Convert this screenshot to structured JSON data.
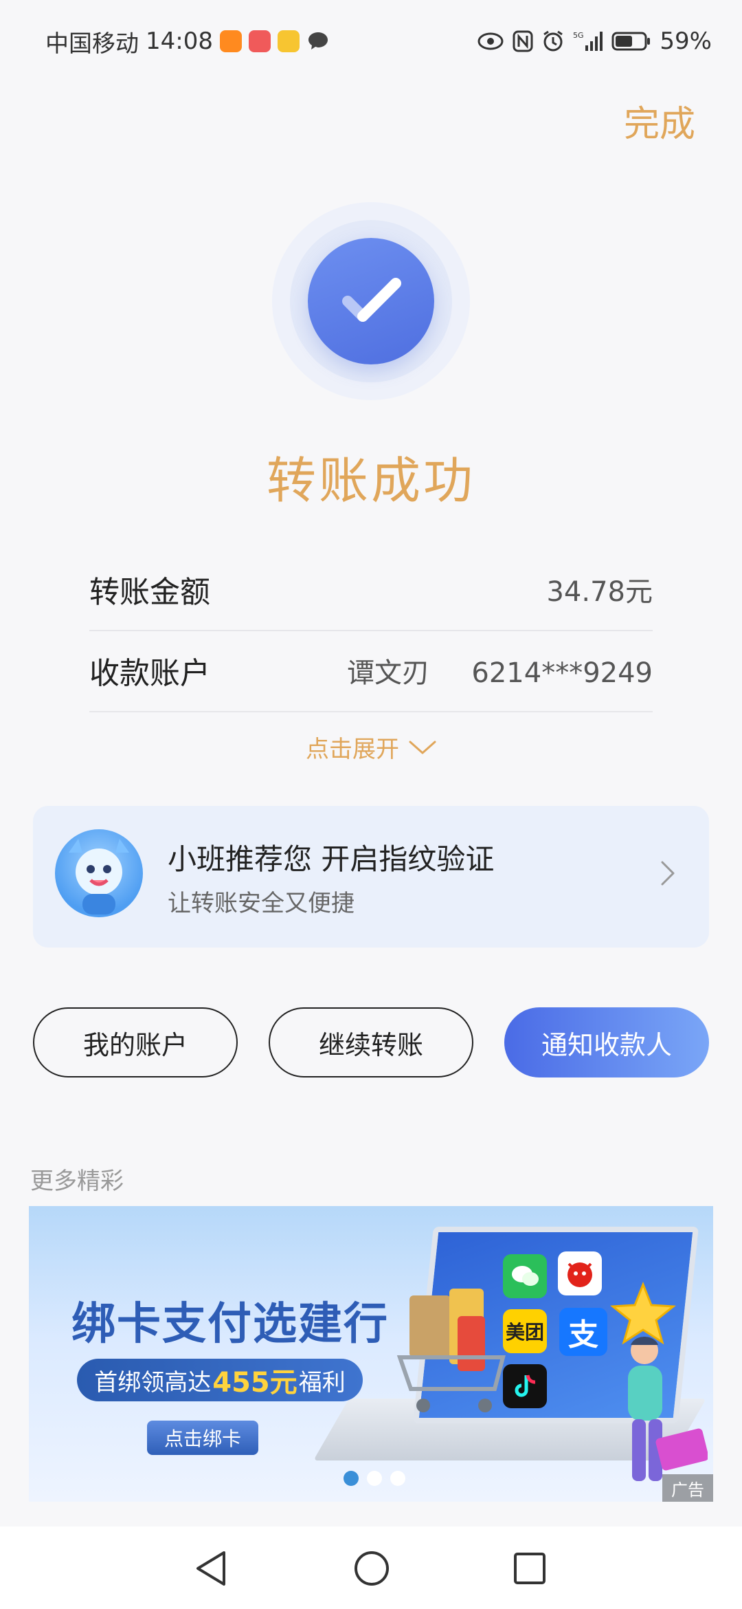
{
  "status_bar": {
    "carrier": "中国移动",
    "time": "14:08",
    "network": "5G",
    "battery": "59%",
    "notification_icons": [
      "taobao-icon",
      "book-icon",
      "qimao-icon",
      "chat-bubble-icon"
    ],
    "system_icons": [
      "eye-icon",
      "nfc-icon",
      "alarm-icon",
      "signal-icon",
      "battery-icon"
    ]
  },
  "header": {
    "done_label": "完成"
  },
  "result": {
    "title": "转账成功"
  },
  "details": [
    {
      "label": "转账金额",
      "value": "34.78元"
    },
    {
      "label": "收款账户",
      "name": "谭文刃",
      "account": "6214***9249"
    }
  ],
  "expand_label": "点击展开",
  "recommend": {
    "title": "小班推荐您 开启指纹验证",
    "subtitle": "让转账安全又便捷"
  },
  "buttons": {
    "my_account": "我的账户",
    "continue": "继续转账",
    "notify": "通知收款人"
  },
  "more_section": {
    "title": "更多精彩"
  },
  "banner": {
    "headline": "绑卡支付选建行",
    "pill_prefix": "首绑领高达",
    "pill_highlight": "455元",
    "pill_suffix": "福利",
    "cta": "点击绑卡",
    "ad_tag": "广告",
    "app_labels": [
      "美团",
      "支"
    ],
    "slide_index": 1,
    "slide_count": 3
  },
  "colors": {
    "accent": "#e0a65a",
    "primary_blue": "#4a6be6",
    "card_bg": "#eaf0fb"
  }
}
